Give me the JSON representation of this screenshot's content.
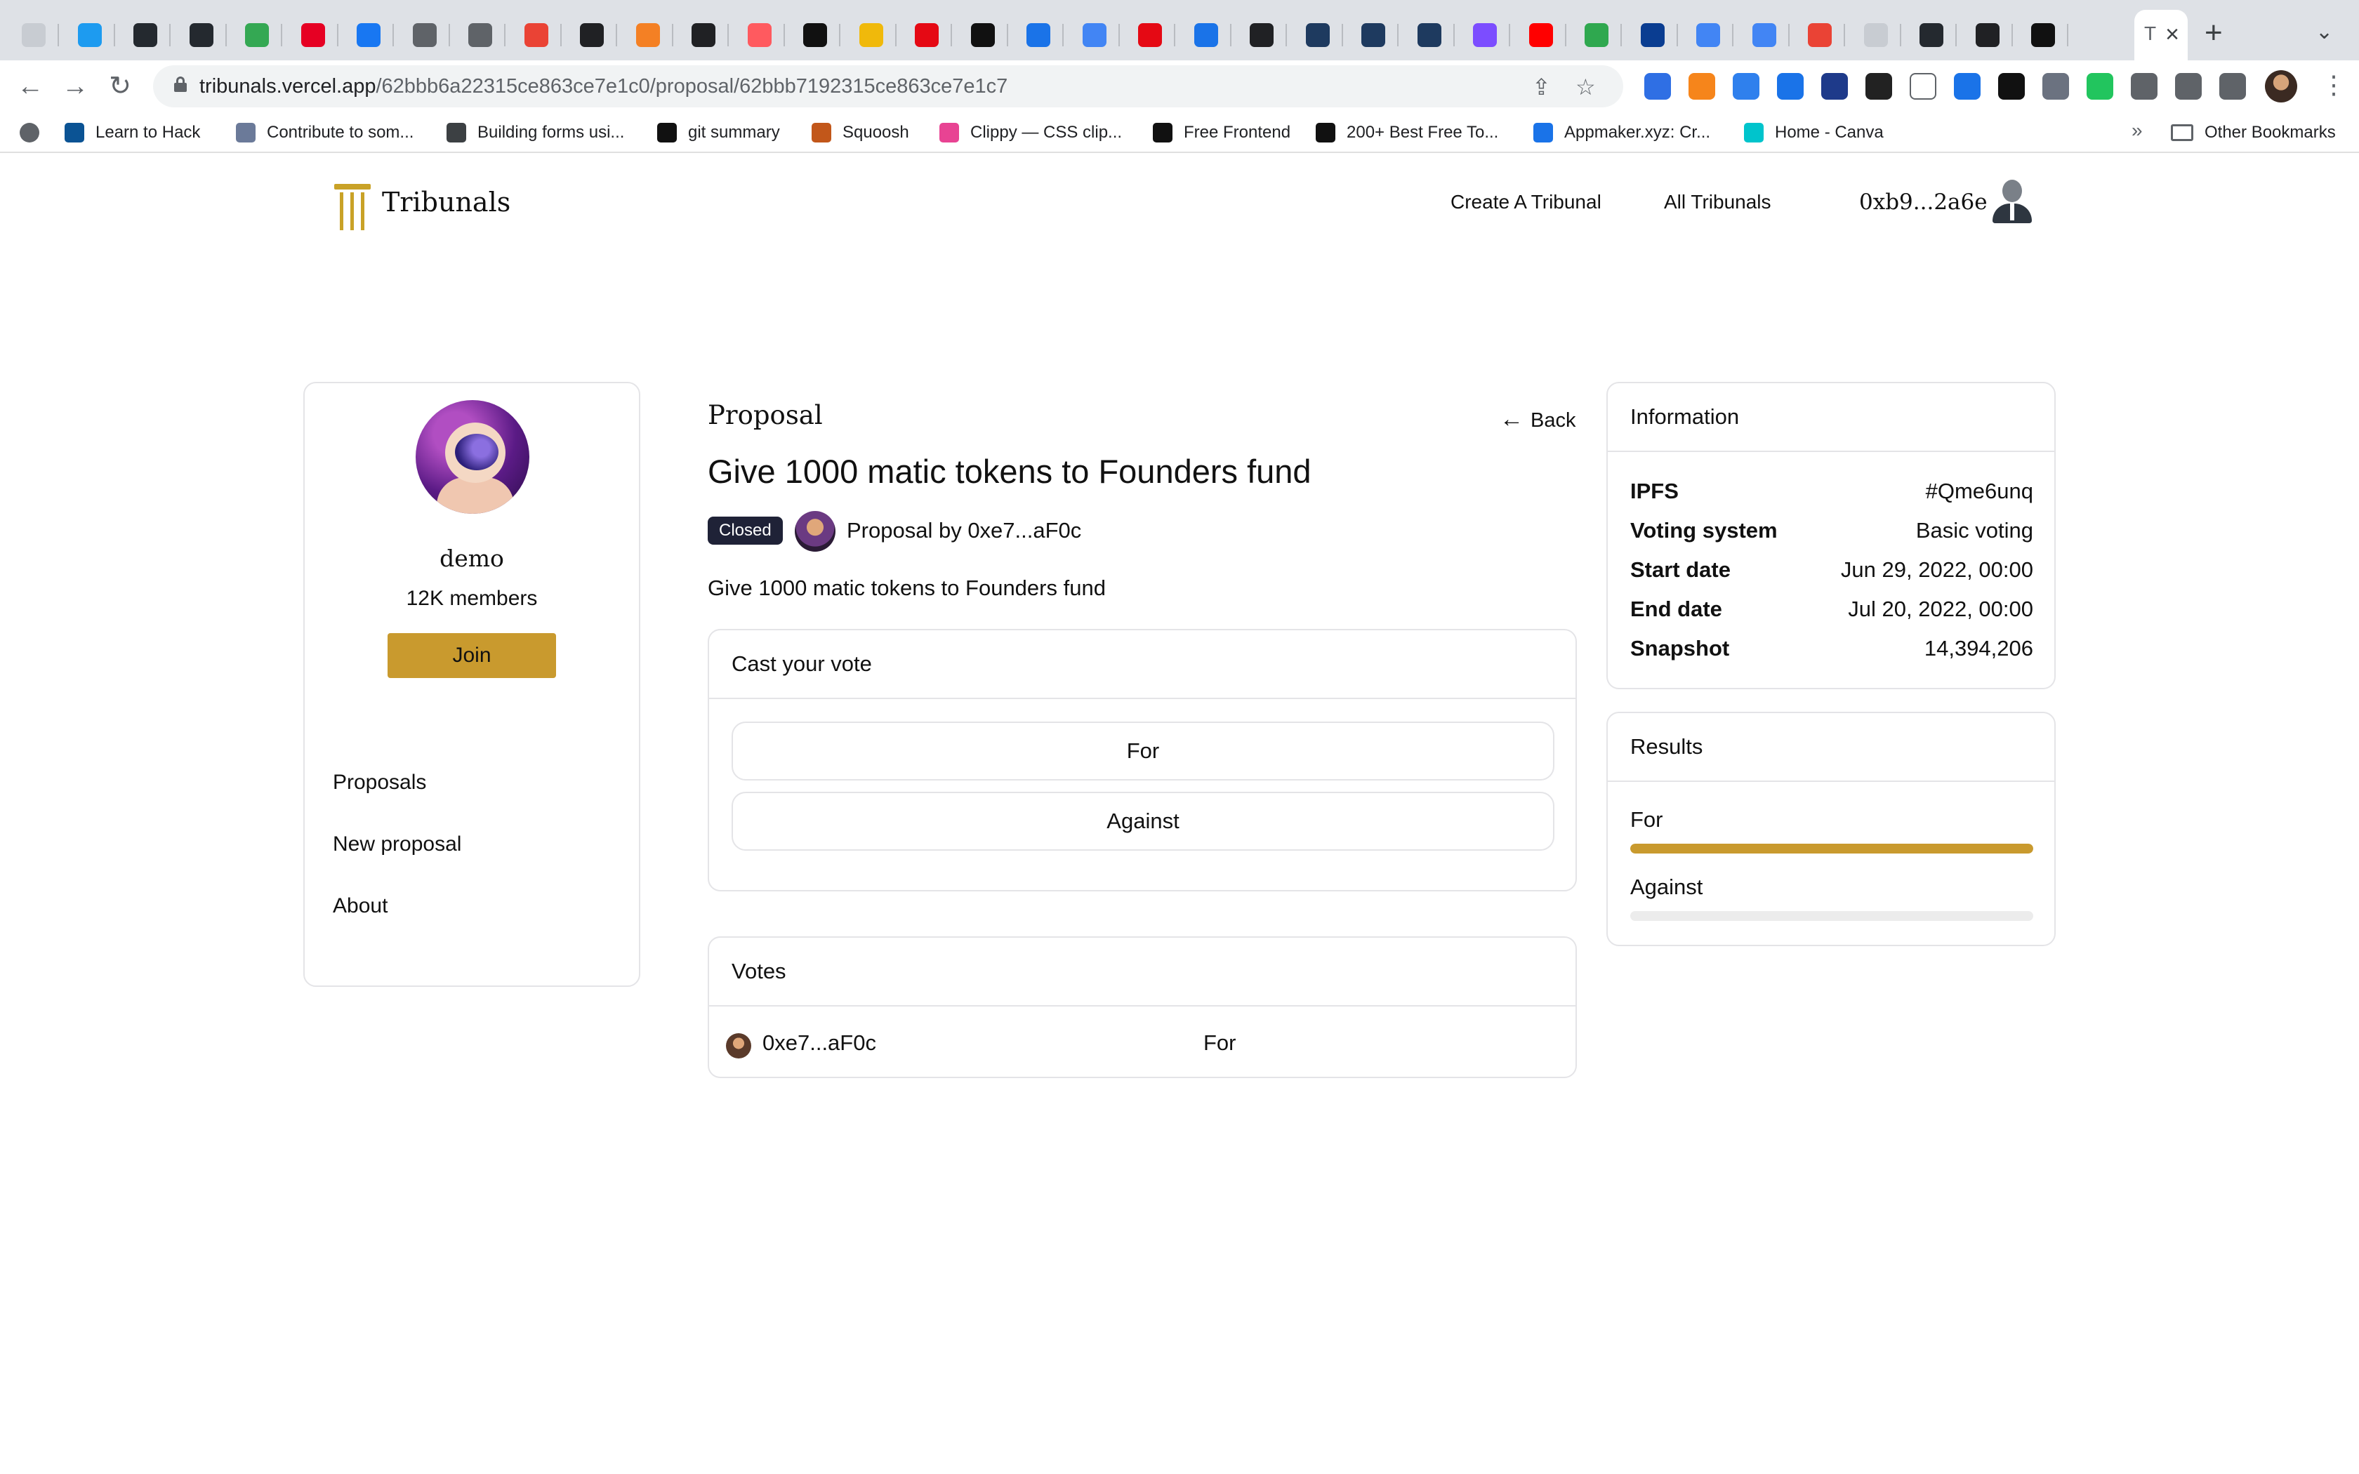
{
  "browser": {
    "url_host": "tribunals.vercel.app",
    "url_path": "/62bbb6a22315ce863ce7e1c0/proposal/62bbb7192315ce863ce7e1c7",
    "active_tab_title": "T",
    "tab_close_glyph": "×",
    "new_tab_glyph": "+",
    "tab_menu_glyph": "⌄",
    "tab_favicon_colors": [
      "#c8ccd2",
      "#1d9bf0",
      "#24292f",
      "#24292f",
      "#34a853",
      "#e60023",
      "#1877f2",
      "#5f6368",
      "#5f6368",
      "#ea4335",
      "#202124",
      "#f48024",
      "#202124",
      "#ff5a5f",
      "#111111",
      "#f0b90b",
      "#e50914",
      "#111111",
      "#1a73e8",
      "#4285f4",
      "#e50914",
      "#1a73e8",
      "#202124",
      "#1e3a5f",
      "#1e3a5f",
      "#1e3a5f",
      "#7c4dff",
      "#ff0000",
      "#2fa84f",
      "#0a3d91",
      "#4285f4",
      "#4285f4",
      "#ea4335",
      "#c8ccd2",
      "#24292f",
      "#202124",
      "#111111"
    ],
    "bookmarks": [
      {
        "label": "Learn to Hack",
        "color": "#0b5394"
      },
      {
        "label": "Contribute to som...",
        "color": "#6b7a99"
      },
      {
        "label": "Building forms usi...",
        "color": "#3c4043"
      },
      {
        "label": "git summary",
        "color": "#111111"
      },
      {
        "label": "Squoosh",
        "color": "#c2571a"
      },
      {
        "label": "Clippy — CSS clip...",
        "color": "#e84393"
      },
      {
        "label": "Free Frontend",
        "color": "#111111"
      },
      {
        "label": "200+ Best Free To...",
        "color": "#111111"
      },
      {
        "label": "Appmaker.xyz: Cr...",
        "color": "#1a73e8"
      },
      {
        "label": "Home - Canva",
        "color": "#00c4cc"
      }
    ],
    "bookmarks_more": "»",
    "other_bookmarks": "Other Bookmarks"
  },
  "header": {
    "brand": "Tribunals",
    "nav": [
      "Create A Tribunal",
      "All Tribunals"
    ],
    "wallet": "0xb9...2a6e"
  },
  "space": {
    "name": "demo",
    "members": "12K members",
    "join_label": "Join",
    "links": [
      "Proposals",
      "New proposal",
      "About"
    ]
  },
  "proposal": {
    "section_label": "Proposal",
    "back_arrow": "←",
    "back_label": "Back",
    "title": "Give 1000 matic tokens to Founders fund",
    "status": "Closed",
    "author_line": "Proposal by 0xe7...aF0c",
    "body": "Give 1000 matic tokens to Founders fund"
  },
  "cast_vote": {
    "heading": "Cast your vote",
    "options": [
      "For",
      "Against"
    ]
  },
  "votes": {
    "heading": "Votes",
    "rows": [
      {
        "address": "0xe7...aF0c",
        "choice": "For"
      }
    ]
  },
  "information": {
    "heading": "Information",
    "rows": [
      {
        "key": "IPFS",
        "value": "#Qme6unq"
      },
      {
        "key": "Voting system",
        "value": "Basic voting"
      },
      {
        "key": "Start date",
        "value": "Jun 29, 2022, 00:00"
      },
      {
        "key": "End date",
        "value": "Jul 20, 2022, 00:00"
      },
      {
        "key": "Snapshot",
        "value": "14,394,206"
      }
    ]
  },
  "results": {
    "heading": "Results",
    "items": [
      {
        "label": "For",
        "fraction": 1.0,
        "color": "#c99a2e"
      },
      {
        "label": "Against",
        "fraction": 0.0,
        "color": "#c99a2e"
      }
    ]
  },
  "colors": {
    "accent": "#c99a2e",
    "badge_bg": "#1f2237",
    "border": "#e4e4e7"
  }
}
